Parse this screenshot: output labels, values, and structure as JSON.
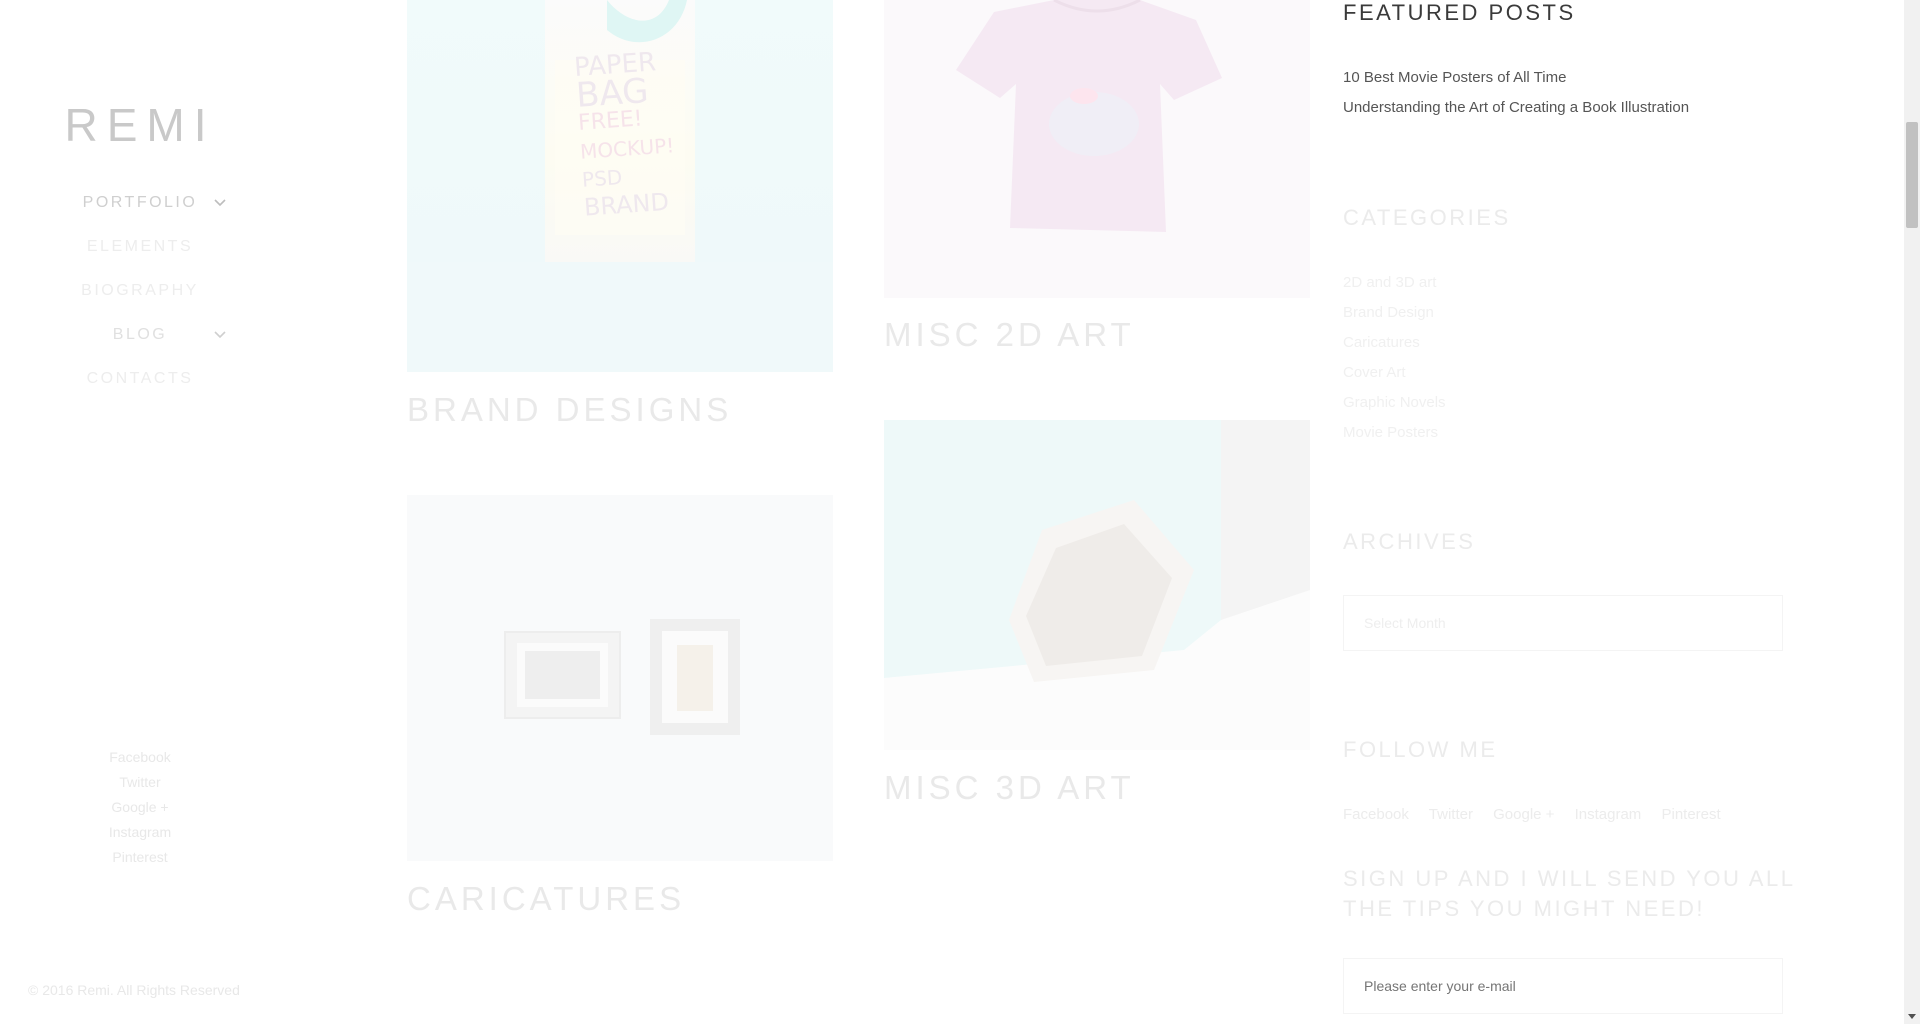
{
  "brand": {
    "logo": "REMI"
  },
  "nav": [
    {
      "label": "PORTFOLIO"
    },
    {
      "label": "ELEMENTS"
    },
    {
      "label": "BIOGRAPHY"
    },
    {
      "label": "BLOG"
    },
    {
      "label": "CONTACTS"
    }
  ],
  "sidebar_social": [
    "Facebook",
    "Twitter",
    "Google +",
    "Instagram",
    "Pinterest"
  ],
  "copyright": "© 2016 Remi. All Rights Reserved",
  "portfolio": [
    {
      "title": "BRAND DESIGNS",
      "image": "paper-bag-mockup",
      "image_text": [
        "PAPER",
        "BAG",
        "FREE!",
        "MOCKUP!",
        "PSD",
        "BRAND"
      ]
    },
    {
      "title": "MISC 2D ART",
      "image": "tshirt-mockup"
    },
    {
      "title": "CARICATURES",
      "image": "framed-caricatures"
    },
    {
      "title": "MISC 3D ART",
      "image": "brochure-mockup"
    }
  ],
  "featured_posts": {
    "title": "FEATURED POSTS",
    "items": [
      "10 Best Movie Posters of All Time",
      "Understanding the Art of Creating a Book Illustration"
    ]
  },
  "categories": {
    "title": "CATEGORIES",
    "items": [
      "2D and 3D art",
      "Brand Design",
      "Caricatures",
      "Cover Art",
      "Graphic Novels",
      "Movie Posters"
    ]
  },
  "archives": {
    "title": "ARCHIVES",
    "select_value": "Select Month"
  },
  "follow": {
    "title": "FOLLOW ME",
    "items": [
      "Facebook",
      "Twitter",
      "Google +",
      "Instagram",
      "Pinterest"
    ]
  },
  "signup": {
    "title": "SIGN UP AND I WILL SEND YOU ALL THE TIPS YOU MIGHT NEED!",
    "placeholder": "Please enter your e-mail"
  },
  "colors": {
    "background": "#ffffff",
    "logo": "#c9c9c9",
    "faded_text": "#ececec",
    "dark_heading": "#3a3a3a",
    "post_link": "#555555"
  }
}
